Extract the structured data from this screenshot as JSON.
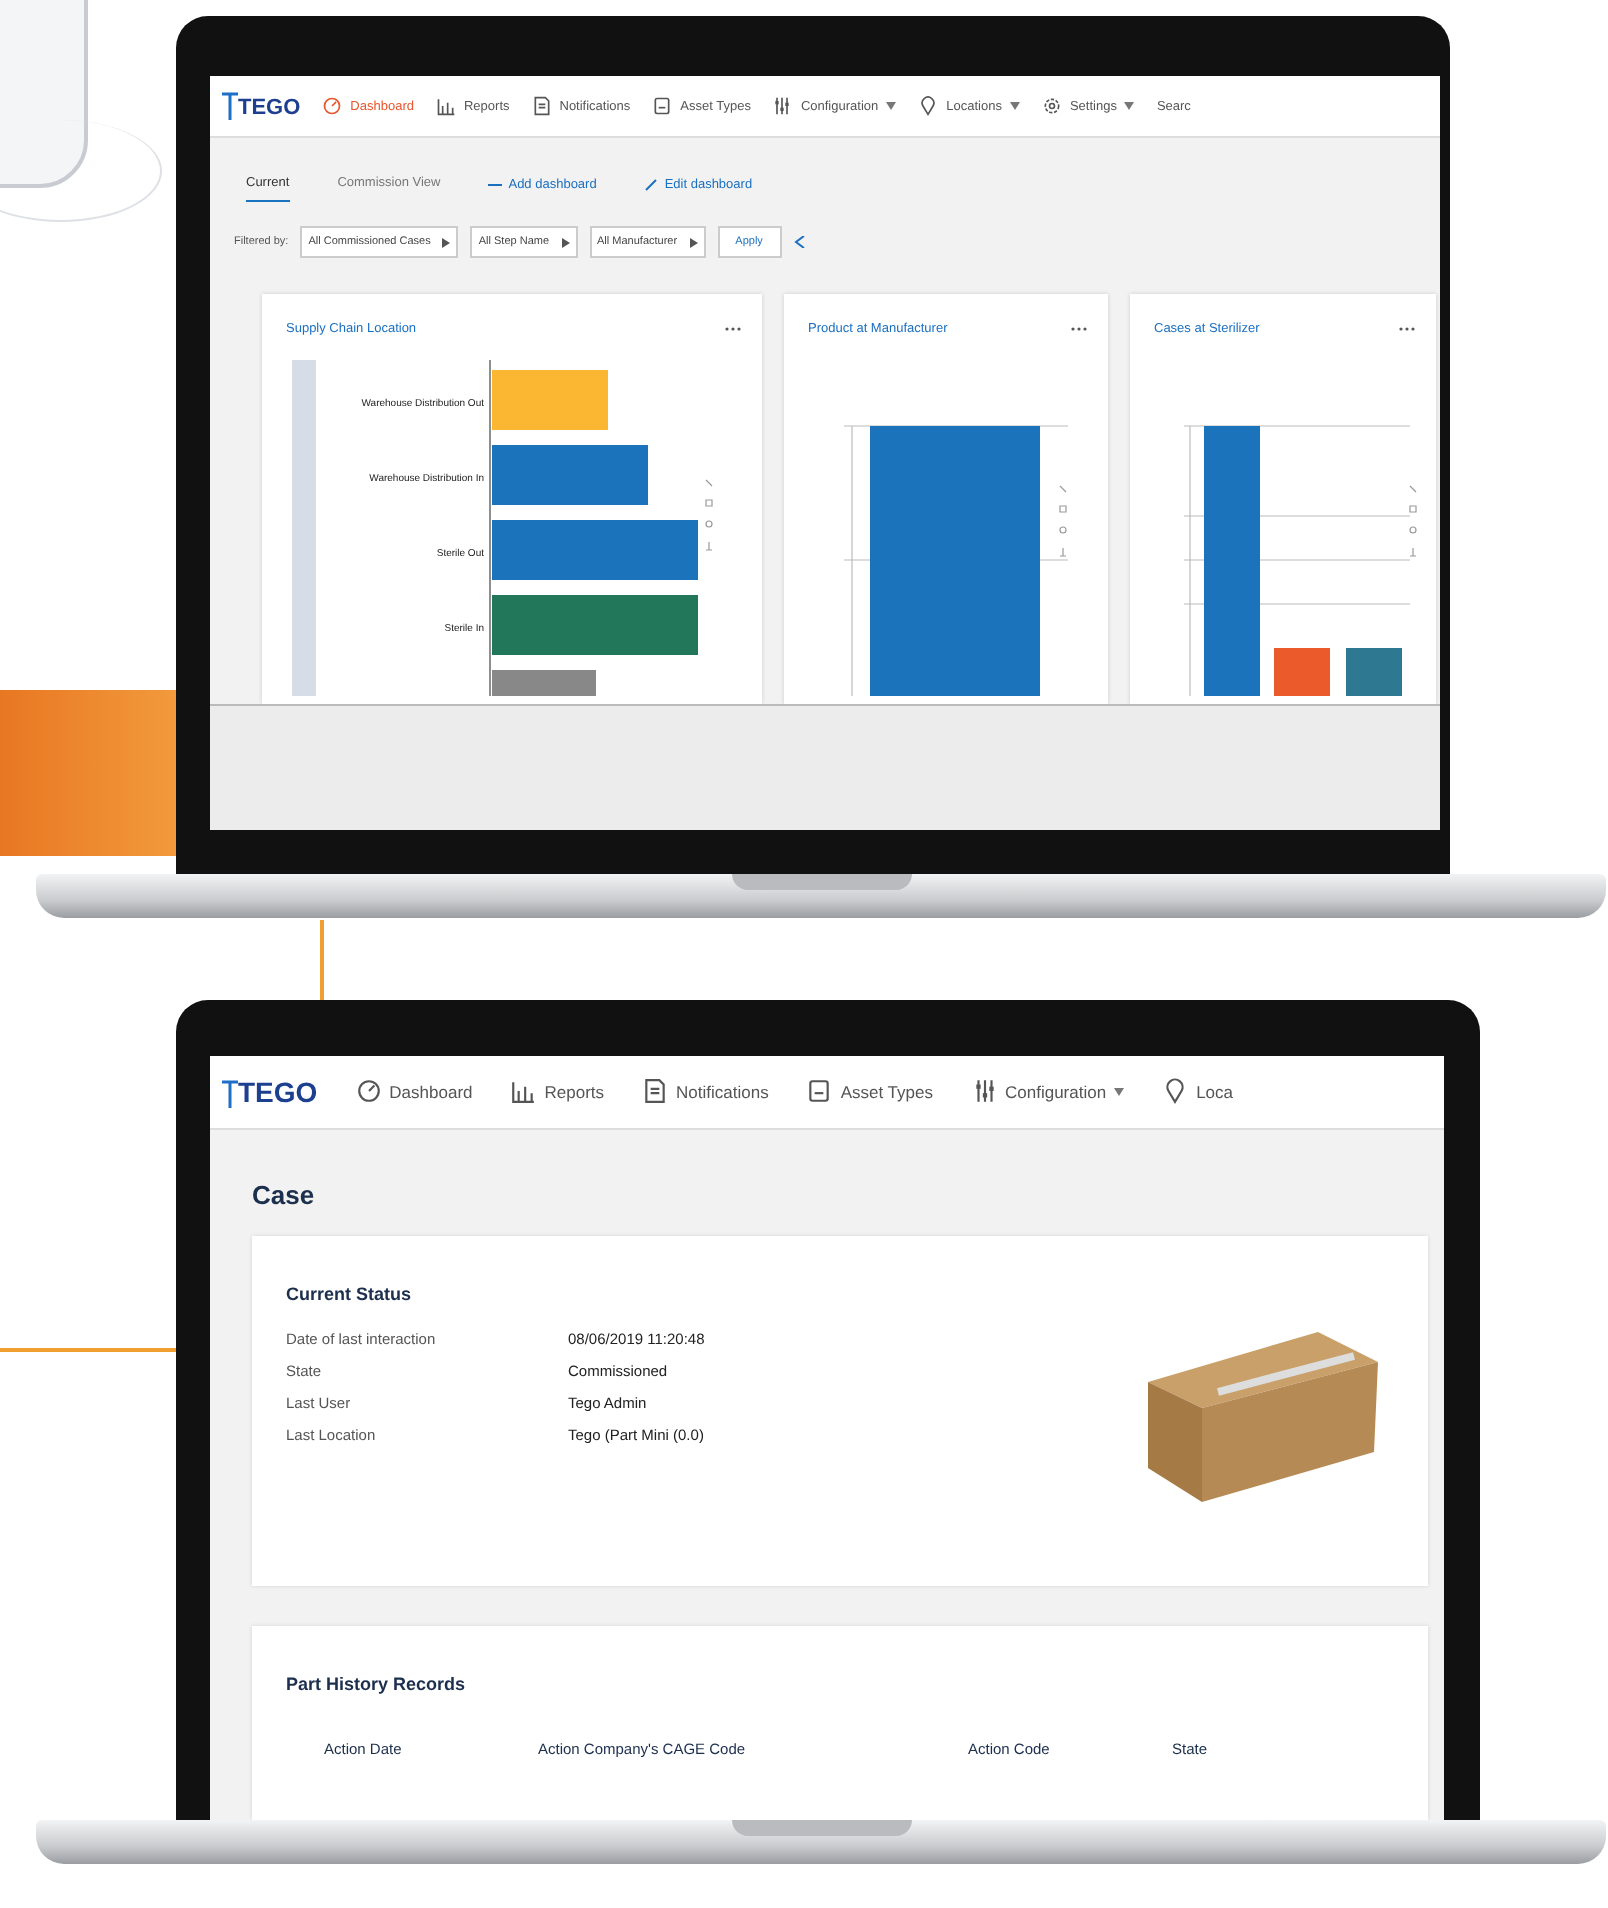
{
  "top_laptop": {
    "nav": {
      "logo": "TEGO",
      "items": [
        {
          "label": "Dashboard",
          "selected": true,
          "dropdown": false
        },
        {
          "label": "Reports",
          "selected": false,
          "dropdown": false
        },
        {
          "label": "Notifications",
          "selected": false,
          "dropdown": false
        },
        {
          "label": "Asset Types",
          "selected": false,
          "dropdown": false
        },
        {
          "label": "Configuration",
          "selected": false,
          "dropdown": true
        },
        {
          "label": "Locations",
          "selected": false,
          "dropdown": true
        },
        {
          "label": "Settings",
          "selected": false,
          "dropdown": true
        },
        {
          "label": "Searc",
          "selected": false,
          "dropdown": false
        }
      ]
    },
    "tabs": [
      {
        "label": "Current",
        "selected": true
      },
      {
        "label": "Commission View",
        "selected": false
      }
    ],
    "actions": [
      "Add dashboard",
      "Edit dashboard"
    ],
    "filters": {
      "label": "Filtered by:",
      "selects": [
        "All Commissioned Cases",
        "All Step Name",
        "All Manufacturer"
      ],
      "apply": "Apply"
    },
    "cards": [
      {
        "title": "Supply Chain Location",
        "kind": "hbar",
        "labels": [
          "Warehouse Distribution Out",
          "Warehouse Distribution In",
          "Sterile Out",
          "Sterile In"
        ]
      },
      {
        "title": "Product at Manufacturer",
        "kind": "single-column"
      },
      {
        "title": "Cases at Sterilizer",
        "kind": "grouped-column"
      }
    ]
  },
  "bottom_laptop": {
    "nav": {
      "logo": "TEGO",
      "items": [
        {
          "label": "Dashboard",
          "selected": false,
          "dropdown": false
        },
        {
          "label": "Reports",
          "selected": false,
          "dropdown": false
        },
        {
          "label": "Notifications",
          "selected": false,
          "dropdown": false
        },
        {
          "label": "Asset Types",
          "selected": false,
          "dropdown": false
        },
        {
          "label": "Configuration",
          "selected": false,
          "dropdown": true
        },
        {
          "label": "Loca",
          "selected": false,
          "dropdown": false
        }
      ]
    },
    "title": "Case",
    "current_status": {
      "title": "Current Status",
      "fields": [
        {
          "label": "Date of last interaction",
          "value": "08/06/2019 11:20:48"
        },
        {
          "label": "State",
          "value": "Commissioned"
        },
        {
          "label": "Last User",
          "value": "Tego Admin"
        },
        {
          "label": "Last Location",
          "value": "Tego (Part Mini (0.0)"
        }
      ]
    },
    "history": {
      "title": "Part History Records",
      "columns": [
        "Action Date",
        "Action Company's CAGE Code",
        "Action Code",
        "State"
      ]
    }
  }
}
